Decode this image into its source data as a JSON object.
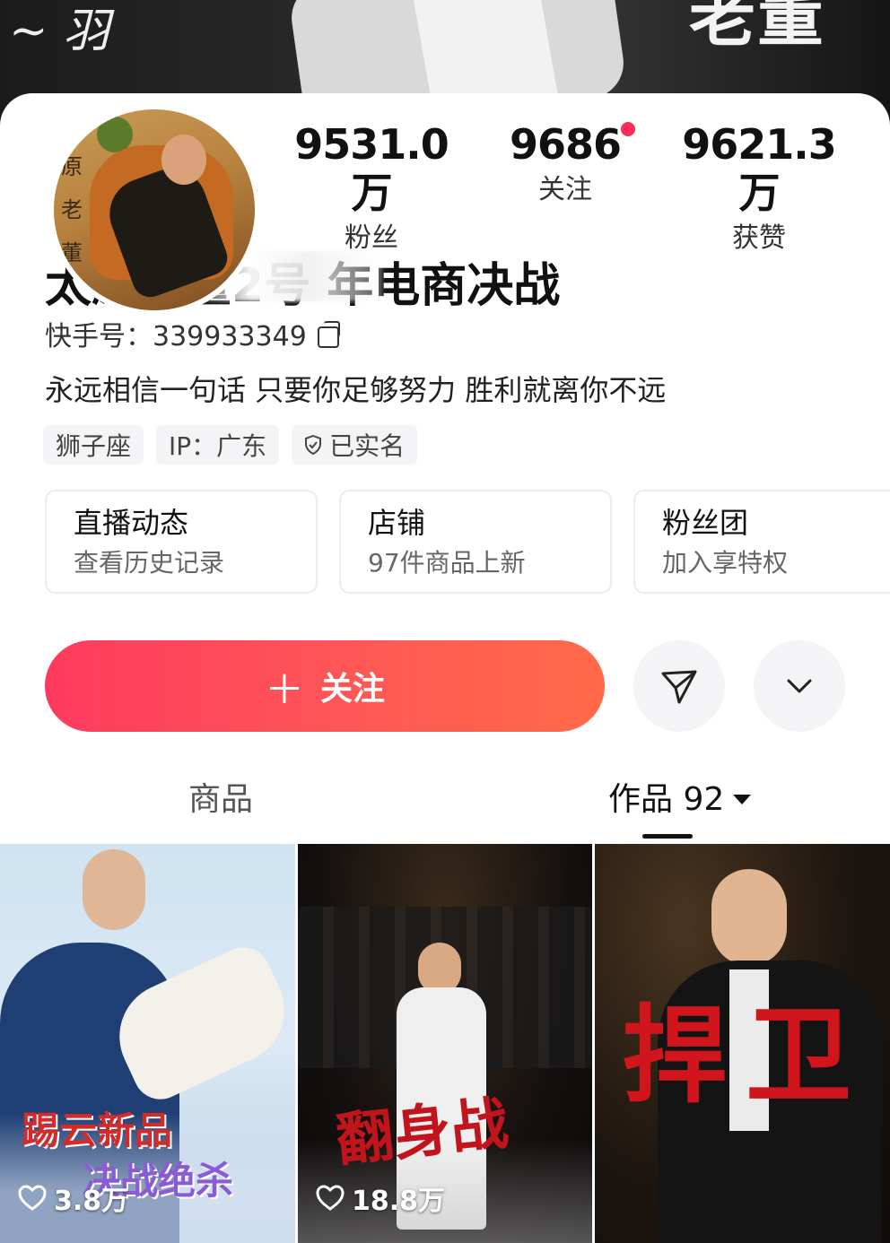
{
  "banner": {
    "overlay_text": "老董"
  },
  "avatar": {
    "chars": "原老董"
  },
  "stats": [
    {
      "value": "9531.0万",
      "label": "粉丝"
    },
    {
      "value": "9686",
      "label": "关注"
    },
    {
      "value": "9621.3万",
      "label": "获赞"
    }
  ],
  "profile": {
    "name": "太原老董2号  年电商决战",
    "kuaishou_id": "快手号：339933349",
    "bio": "永远相信一句话 只要你足够努力 胜利就离你不远"
  },
  "tags": [
    {
      "label": "狮子座",
      "icon": null
    },
    {
      "label": "IP：广东",
      "icon": null
    },
    {
      "label": "已实名",
      "icon": "shield-check-icon"
    }
  ],
  "feature_boxes": [
    {
      "title": "直播动态",
      "subtitle": "查看历史记录"
    },
    {
      "title": "店铺",
      "subtitle": "97件商品上新"
    },
    {
      "title": "粉丝团",
      "subtitle": "加入享特权"
    }
  ],
  "actions": {
    "follow_label": "关注",
    "follow_plus": "＋",
    "share_icon": "send-icon",
    "more_icon": "chevron-down-icon"
  },
  "tabs": [
    {
      "label": "商品",
      "active": false
    },
    {
      "label": "作品 92",
      "active": true
    }
  ],
  "grid": [
    {
      "line1": "踢云新品",
      "line2": "决战绝杀",
      "likes": "3.8万"
    },
    {
      "title": "翻身战",
      "likes": "18.8万"
    },
    {
      "title": "捍卫",
      "likes": ""
    }
  ],
  "colors": {
    "accent": "#fe2c55",
    "follow_gradient_start": "#fe3a5f",
    "follow_gradient_end": "#ff6a48"
  }
}
